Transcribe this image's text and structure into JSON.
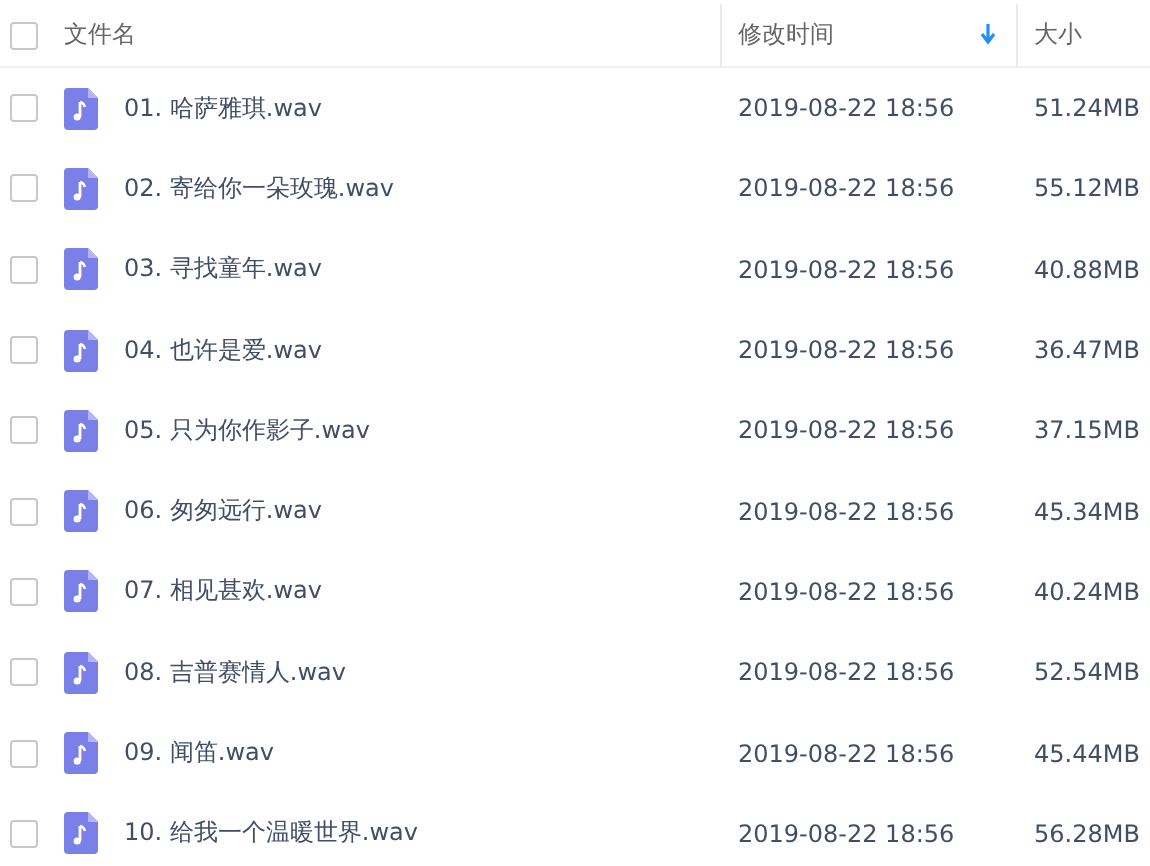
{
  "header": {
    "select_all": {
      "checked": false
    },
    "columns": [
      {
        "label": "文件名",
        "sorted": false
      },
      {
        "label": "修改时间",
        "sorted": true
      },
      {
        "label": "大小",
        "sorted": false
      }
    ]
  },
  "files": [
    {
      "name": "01. 哈萨雅琪.wav",
      "modified": "2019-08-22 18:56",
      "size": "51.24MB",
      "checked": false
    },
    {
      "name": "02. 寄给你一朵玫瑰.wav",
      "modified": "2019-08-22 18:56",
      "size": "55.12MB",
      "checked": false
    },
    {
      "name": "03. 寻找童年.wav",
      "modified": "2019-08-22 18:56",
      "size": "40.88MB",
      "checked": false
    },
    {
      "name": "04. 也许是爱.wav",
      "modified": "2019-08-22 18:56",
      "size": "36.47MB",
      "checked": false
    },
    {
      "name": "05. 只为你作影子.wav",
      "modified": "2019-08-22 18:56",
      "size": "37.15MB",
      "checked": false
    },
    {
      "name": "06. 匆匆远行.wav",
      "modified": "2019-08-22 18:56",
      "size": "45.34MB",
      "checked": false
    },
    {
      "name": "07. 相见甚欢.wav",
      "modified": "2019-08-22 18:56",
      "size": "40.24MB",
      "checked": false
    },
    {
      "name": "08. 吉普赛情人.wav",
      "modified": "2019-08-22 18:56",
      "size": "52.54MB",
      "checked": false
    },
    {
      "name": "09. 闻笛.wav",
      "modified": "2019-08-22 18:56",
      "size": "45.44MB",
      "checked": false
    },
    {
      "name": "10. 给我一个温暖世界.wav",
      "modified": "2019-08-22 18:56",
      "size": "56.28MB",
      "checked": false
    }
  ]
}
